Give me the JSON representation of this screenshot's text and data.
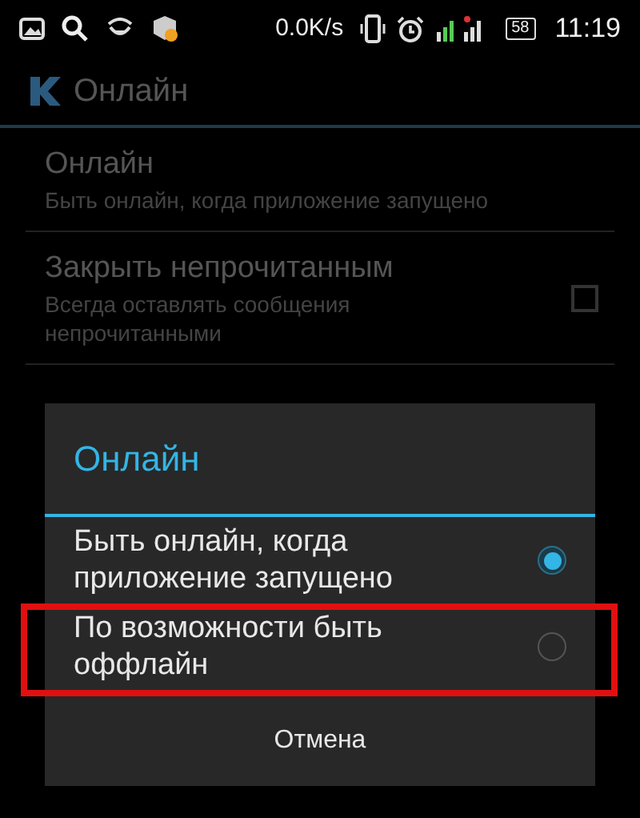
{
  "status_bar": {
    "speed": "0.0K/s",
    "battery": "58",
    "time": "11:19"
  },
  "action_bar": {
    "title": "Онлайн"
  },
  "settings": [
    {
      "kind": "text",
      "title": "Онлайн",
      "summary": "Быть онлайн, когда приложение запущено"
    },
    {
      "kind": "checkbox",
      "title": "Закрыть непрочитанным",
      "summary": "Всегда оставлять сообщения непрочитанными",
      "checked": false
    }
  ],
  "dialog": {
    "title": "Онлайн",
    "options": [
      {
        "label": "Быть онлайн, когда приложение запущено",
        "selected": true,
        "highlighted": false
      },
      {
        "label": "По возможности быть оффлайн",
        "selected": false,
        "highlighted": true
      }
    ],
    "cancel": "Отмена"
  }
}
